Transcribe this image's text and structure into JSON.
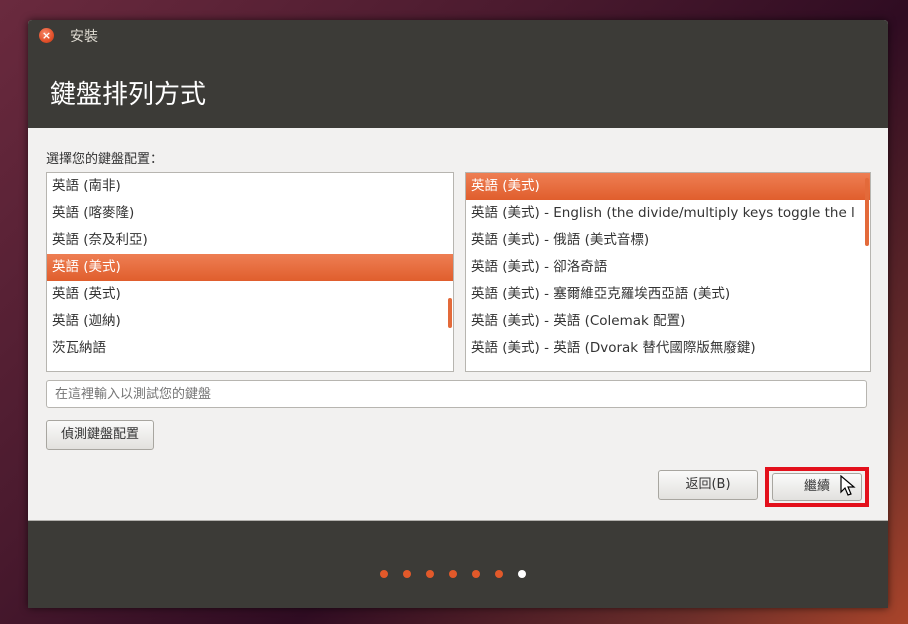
{
  "window": {
    "title": "安裝"
  },
  "header": {
    "title": "鍵盤排列方式"
  },
  "layout_prompt": "選擇您的鍵盤配置：",
  "layouts_left": [
    {
      "label": "英語 (南非)",
      "selected": false
    },
    {
      "label": "英語 (喀麥隆)",
      "selected": false
    },
    {
      "label": "英語 (奈及利亞)",
      "selected": false
    },
    {
      "label": "英語 (美式)",
      "selected": true
    },
    {
      "label": "英語 (英式)",
      "selected": false
    },
    {
      "label": "英語 (迦納)",
      "selected": false
    },
    {
      "label": "茨瓦納語",
      "selected": false
    }
  ],
  "variants_right": [
    {
      "label": "英語 (美式)",
      "selected": true
    },
    {
      "label": "英語 (美式) - English (the divide/multiply keys toggle the l",
      "selected": false
    },
    {
      "label": "英語 (美式) - 俄語 (美式音標)",
      "selected": false
    },
    {
      "label": "英語 (美式) - 卻洛奇語",
      "selected": false
    },
    {
      "label": "英語 (美式) - 塞爾維亞克羅埃西亞語 (美式)",
      "selected": false
    },
    {
      "label": "英語 (美式) - 英語 (Colemak 配置)",
      "selected": false
    },
    {
      "label": "英語 (美式) - 英語 (Dvorak 替代國際版無廢鍵)",
      "selected": false
    }
  ],
  "test_input": {
    "placeholder": "在這裡輸入以測試您的鍵盤",
    "value": ""
  },
  "buttons": {
    "detect": "偵測鍵盤配置",
    "back": "返回(B)",
    "continue": "繼續"
  },
  "progress": {
    "total_steps": 7,
    "current_step": 7
  },
  "colors": {
    "accent": "#e05e2d",
    "highlight": "#e3101b",
    "chrome": "#3c3b37"
  }
}
